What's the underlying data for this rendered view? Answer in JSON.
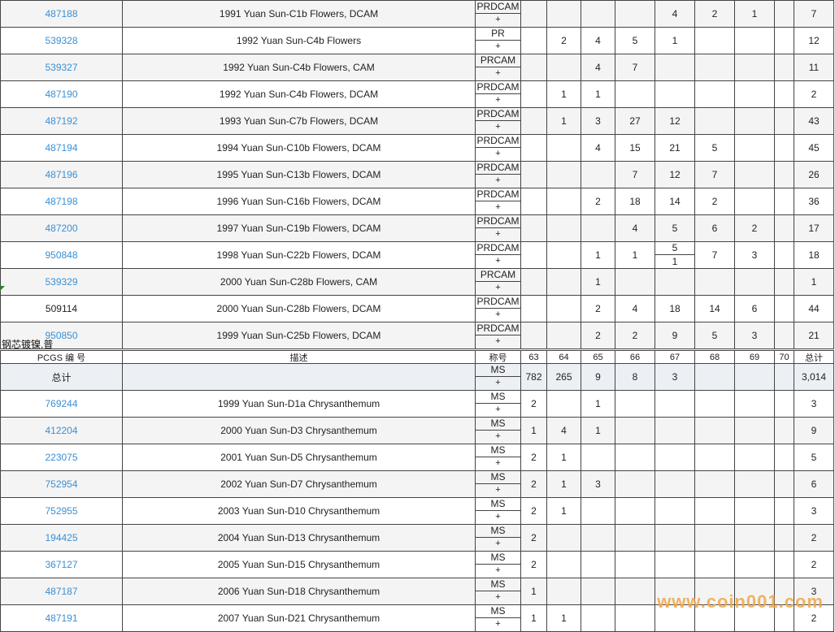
{
  "section_prc": {
    "rows": [
      {
        "pcgs": "487188",
        "desc": "1991 Yuan Sun-C1b Flowers, DCAM",
        "des": "PRDCAM",
        "plus": "+",
        "g": [
          "",
          "",
          "",
          "",
          "4",
          "2",
          "1",
          ""
        ],
        "total": "7",
        "alt": true,
        "link": true
      },
      {
        "pcgs": "539328",
        "desc": "1992 Yuan Sun-C4b Flowers",
        "des": "PR",
        "plus": "+",
        "g": [
          "",
          "2",
          "4",
          "5",
          "1",
          "",
          "",
          ""
        ],
        "total": "12",
        "alt": false,
        "link": true
      },
      {
        "pcgs": "539327",
        "desc": "1992 Yuan Sun-C4b Flowers, CAM",
        "des": "PRCAM",
        "plus": "+",
        "g": [
          "",
          "",
          "4",
          "7",
          "",
          "",
          "",
          ""
        ],
        "total": "11",
        "alt": true,
        "link": true
      },
      {
        "pcgs": "487190",
        "desc": "1992 Yuan Sun-C4b Flowers, DCAM",
        "des": "PRDCAM",
        "plus": "+",
        "g": [
          "",
          "1",
          "1",
          "",
          "",
          "",
          "",
          ""
        ],
        "total": "2",
        "alt": false,
        "link": true
      },
      {
        "pcgs": "487192",
        "desc": "1993 Yuan Sun-C7b Flowers, DCAM",
        "des": "PRDCAM",
        "plus": "+",
        "g": [
          "",
          "1",
          "3",
          "27",
          "12",
          "",
          "",
          ""
        ],
        "total": "43",
        "alt": true,
        "link": true
      },
      {
        "pcgs": "487194",
        "desc": "1994 Yuan Sun-C10b Flowers, DCAM",
        "des": "PRDCAM",
        "plus": "+",
        "g": [
          "",
          "",
          "4",
          "15",
          "21",
          "5",
          "",
          ""
        ],
        "total": "45",
        "alt": false,
        "link": true
      },
      {
        "pcgs": "487196",
        "desc": "1995 Yuan Sun-C13b Flowers, DCAM",
        "des": "PRDCAM",
        "plus": "+",
        "g": [
          "",
          "",
          "",
          "7",
          "12",
          "7",
          "",
          ""
        ],
        "total": "26",
        "alt": true,
        "link": true
      },
      {
        "pcgs": "487198",
        "desc": "1996 Yuan Sun-C16b Flowers, DCAM",
        "des": "PRDCAM",
        "plus": "+",
        "g": [
          "",
          "",
          "2",
          "18",
          "14",
          "2",
          "",
          ""
        ],
        "total": "36",
        "alt": false,
        "link": true
      },
      {
        "pcgs": "487200",
        "desc": "1997 Yuan Sun-C19b Flowers, DCAM",
        "des": "PRDCAM",
        "plus": "+",
        "g": [
          "",
          "",
          "",
          "4",
          "5",
          "6",
          "2",
          ""
        ],
        "total": "17",
        "alt": true,
        "link": true
      },
      {
        "pcgs": "950848",
        "desc": "1998 Yuan Sun-C22b Flowers, DCAM",
        "des": "PRDCAM",
        "plus": "+",
        "g": [
          "",
          "",
          "1",
          "1",
          "",
          "7",
          "3",
          ""
        ],
        "g67split": [
          "5",
          "1"
        ],
        "total": "18",
        "alt": false,
        "link": true
      },
      {
        "pcgs": "539329",
        "desc": "2000 Yuan Sun-C28b Flowers, CAM",
        "des": "PRCAM",
        "plus": "+",
        "g": [
          "",
          "",
          "1",
          "",
          "",
          "",
          "",
          ""
        ],
        "total": "1",
        "alt": true,
        "link": true
      },
      {
        "pcgs": "509114",
        "desc": "2000 Yuan Sun-C28b Flowers, DCAM",
        "des": "PRDCAM",
        "plus": "+",
        "g": [
          "",
          "",
          "2",
          "4",
          "18",
          "14",
          "6",
          ""
        ],
        "total": "44",
        "alt": false,
        "link": false
      },
      {
        "pcgs": "950850",
        "desc": "1999 Yuan Sun-C25b Flowers, DCAM",
        "des": "PRDCAM",
        "plus": "+",
        "g": [
          "",
          "",
          "2",
          "2",
          "9",
          "5",
          "3",
          ""
        ],
        "total": "21",
        "alt": true,
        "link": true
      }
    ]
  },
  "group_title": "钢芯镀镍,普",
  "header": {
    "pcgs": "PCGS 编 号",
    "desc": "描述",
    "des": "称号",
    "grades": [
      "63",
      "64",
      "65",
      "66",
      "67",
      "68",
      "69",
      "70"
    ],
    "total": "总计"
  },
  "section_ms": {
    "total_row": {
      "label": "总计",
      "des": "MS",
      "plus": "+",
      "g": [
        "782",
        "265",
        "9",
        "8",
        "3",
        "",
        "",
        ""
      ],
      "total": "3,014"
    },
    "rows": [
      {
        "pcgs": "769244",
        "desc": "1999 Yuan Sun-D1a Chrysanthemum",
        "des": "MS",
        "plus": "+",
        "g": [
          "2",
          "",
          "1",
          "",
          "",
          "",
          "",
          ""
        ],
        "total": "3",
        "alt": false
      },
      {
        "pcgs": "412204",
        "desc": "2000 Yuan Sun-D3 Chrysanthemum",
        "des": "MS",
        "plus": "+",
        "g": [
          "1",
          "4",
          "1",
          "",
          "",
          "",
          "",
          ""
        ],
        "total": "9",
        "alt": true
      },
      {
        "pcgs": "223075",
        "desc": "2001 Yuan Sun-D5 Chrysanthemum",
        "des": "MS",
        "plus": "+",
        "g": [
          "2",
          "1",
          "",
          "",
          "",
          "",
          "",
          ""
        ],
        "total": "5",
        "alt": false
      },
      {
        "pcgs": "752954",
        "desc": "2002 Yuan Sun-D7 Chrysanthemum",
        "des": "MS",
        "plus": "+",
        "g": [
          "2",
          "1",
          "3",
          "",
          "",
          "",
          "",
          ""
        ],
        "total": "6",
        "alt": true
      },
      {
        "pcgs": "752955",
        "desc": "2003 Yuan Sun-D10 Chrysanthemum",
        "des": "MS",
        "plus": "+",
        "g": [
          "2",
          "1",
          "",
          "",
          "",
          "",
          "",
          ""
        ],
        "total": "3",
        "alt": false
      },
      {
        "pcgs": "194425",
        "desc": "2004 Yuan Sun-D13 Chrysanthemum",
        "des": "MS",
        "plus": "+",
        "g": [
          "2",
          "",
          "",
          "",
          "",
          "",
          "",
          ""
        ],
        "total": "2",
        "alt": true
      },
      {
        "pcgs": "367127",
        "desc": "2005 Yuan Sun-D15 Chrysanthemum",
        "des": "MS",
        "plus": "+",
        "g": [
          "2",
          "",
          "",
          "",
          "",
          "",
          "",
          ""
        ],
        "total": "2",
        "alt": false
      },
      {
        "pcgs": "487187",
        "desc": "2006 Yuan Sun-D18 Chrysanthemum",
        "des": "MS",
        "plus": "+",
        "g": [
          "1",
          "",
          "",
          "",
          "",
          "",
          "",
          ""
        ],
        "total": "3",
        "alt": true
      },
      {
        "pcgs": "487191",
        "desc": "2007 Yuan Sun-D21 Chrysanthemum",
        "des": "MS",
        "plus": "+",
        "g": [
          "1",
          "1",
          "",
          "",
          "",
          "",
          "",
          ""
        ],
        "total": "2",
        "alt": false
      }
    ]
  },
  "watermark": "www.coin001.com"
}
